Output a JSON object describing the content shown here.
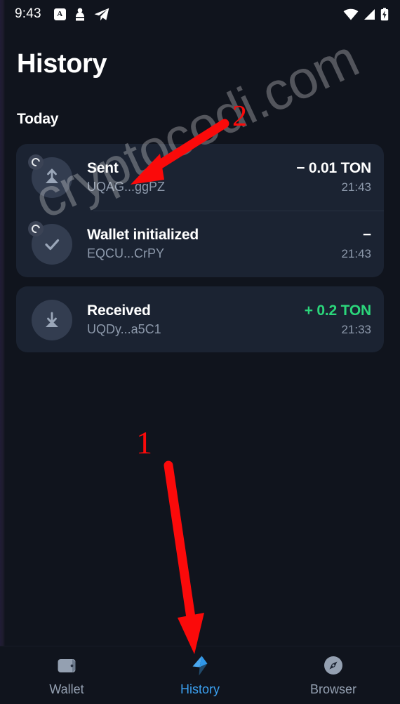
{
  "status_bar": {
    "time": "9:43",
    "left_icons": [
      "translate-icon",
      "person-icon",
      "telegram-icon"
    ],
    "right_icons": [
      "wifi-icon",
      "cellular-signal-icon",
      "battery-charging-icon"
    ],
    "translate_glyph": "A"
  },
  "header": {
    "title": "History",
    "section_label": "Today"
  },
  "transactions": [
    {
      "icon": "arrow-up-icon",
      "pending": true,
      "title": "Sent",
      "address": "UQAG...ggPZ",
      "amount": "− 0.01 TON",
      "amount_type": "negative",
      "time": "21:43"
    },
    {
      "icon": "check-icon",
      "pending": true,
      "title": "Wallet initialized",
      "address": "EQCU...CrPY",
      "amount": "−",
      "amount_type": "neutral",
      "time": "21:43"
    },
    {
      "icon": "arrow-down-icon",
      "pending": false,
      "title": "Received",
      "address": "UQDy...a5C1",
      "amount": "+ 0.2 TON",
      "amount_type": "positive",
      "time": "21:33"
    }
  ],
  "watermark": {
    "text": "cryptocodi.com"
  },
  "annotations": {
    "marker_one": "1",
    "marker_two": "2",
    "color": "#fb0a0a"
  },
  "bottom_nav": {
    "items": [
      {
        "label": "Wallet",
        "icon": "wallet-icon",
        "active": false
      },
      {
        "label": "History",
        "icon": "history-bolt-icon",
        "active": true
      },
      {
        "label": "Browser",
        "icon": "compass-icon",
        "active": false
      }
    ]
  },
  "colors": {
    "background": "#10141d",
    "card": "#1b2332",
    "accent": "#3ba0f0",
    "positive": "#2bd67b",
    "muted_text": "#8d99ab"
  }
}
